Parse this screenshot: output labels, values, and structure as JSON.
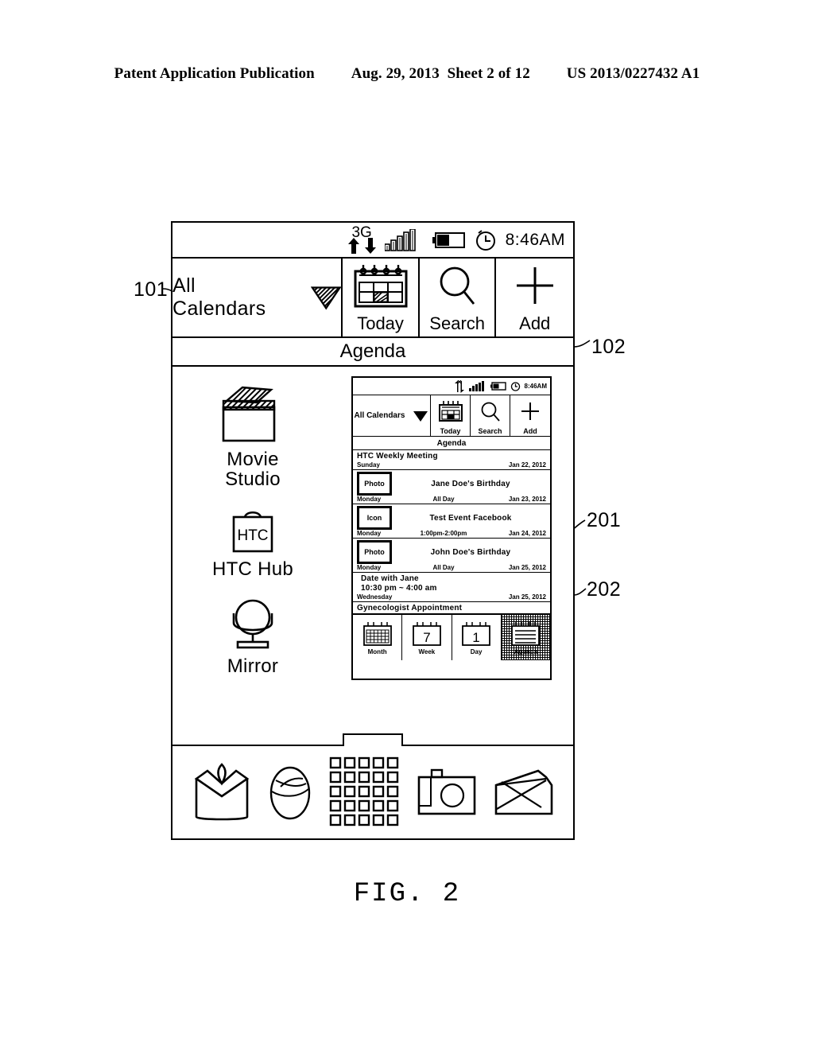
{
  "publication": {
    "left": "Patent Application Publication",
    "center": "Aug. 29, 2013  Sheet 2 of 12",
    "right": "US 2013/0227432 A1"
  },
  "figure": {
    "caption": "FIG. 2"
  },
  "callouts": [
    {
      "id": "101",
      "label": "101"
    },
    {
      "id": "102",
      "label": "102"
    },
    {
      "id": "201",
      "label": "201"
    },
    {
      "id": "202",
      "label": "202"
    }
  ],
  "device": {
    "status_bar": {
      "network": "3G",
      "up_arrow": "up-arrow-icon",
      "down_arrow": "down-arrow-icon",
      "signal": "signal-bars-icon",
      "battery": "battery-icon",
      "alarm": "alarm-clock-icon",
      "time": "8:46AM"
    },
    "toolbar": {
      "calendar_selector": "All Calendars",
      "dropdown": "chevron-down-icon",
      "buttons": [
        {
          "label": "Today",
          "icon": "calendar-icon"
        },
        {
          "label": "Search",
          "icon": "magnifier-icon"
        },
        {
          "label": "Add",
          "icon": "plus-icon"
        }
      ]
    },
    "view_title": "Agenda",
    "apps": [
      {
        "name": "Movie\nStudio",
        "line1": "Movie",
        "line2": "Studio",
        "icon": "clapperboard-icon"
      },
      {
        "name": "HTC Hub",
        "line1": "HTC Hub",
        "line2": "",
        "icon": "shopping-bag-icon",
        "badge": "HTC"
      },
      {
        "name": "Mirror",
        "line1": "Mirror",
        "line2": "",
        "icon": "mirror-icon"
      }
    ],
    "dock": [
      {
        "name": "reader-icon"
      },
      {
        "name": "mouse-icon"
      },
      {
        "name": "all-apps-grid-icon"
      },
      {
        "name": "camera-icon"
      },
      {
        "name": "mail-icon"
      }
    ]
  },
  "thumbnail": {
    "status_bar": {
      "network": "sync-arrows-icon",
      "signal": "signal-bars-icon",
      "battery": "battery-icon",
      "alarm": "alarm-clock-icon",
      "time": "8:46AM"
    },
    "toolbar": {
      "calendar_selector": "All Calendars",
      "dropdown": "chevron-down-icon",
      "buttons": [
        {
          "label": "Today",
          "icon": "calendar-icon"
        },
        {
          "label": "Search",
          "icon": "magnifier-icon"
        },
        {
          "label": "Add",
          "icon": "plus-icon"
        }
      ]
    },
    "view_title": "Agenda",
    "events": [
      {
        "thumb": null,
        "title": "HTC Weekly Meeting",
        "day": "Sunday",
        "time": "",
        "date": "Jan 22, 2012"
      },
      {
        "thumb": "Photo",
        "title": "Jane Doe's Birthday",
        "day": "Monday",
        "time": "All Day",
        "date": "Jan 23, 2012"
      },
      {
        "thumb": "Icon",
        "title": "Test Event Facebook",
        "day": "Monday",
        "time": "1:00pm-2:00pm",
        "date": "Jan 24, 2012"
      },
      {
        "thumb": "Photo",
        "title": "John Doe's Birthday",
        "day": "Monday",
        "time": "All Day",
        "date": "Jan 25, 2012"
      },
      {
        "thumb": null,
        "title": "Date with Jane",
        "title2": "10:30 pm ~ 4:00 am",
        "day": "Wednesday",
        "time": "",
        "date": "Jan 25, 2012"
      },
      {
        "thumb": null,
        "title": "Gynecologist Appointment",
        "day": "",
        "time": "",
        "date": ""
      }
    ],
    "tabs": [
      {
        "label": "Month",
        "icon": "calendar-month-icon",
        "glyph": "",
        "selected": false
      },
      {
        "label": "Week",
        "icon": "calendar-week-icon",
        "glyph": "7",
        "selected": false
      },
      {
        "label": "Day",
        "icon": "calendar-day-icon",
        "glyph": "1",
        "selected": false
      },
      {
        "label": "Agenda",
        "icon": "agenda-list-icon",
        "glyph": "",
        "selected": true
      }
    ]
  }
}
